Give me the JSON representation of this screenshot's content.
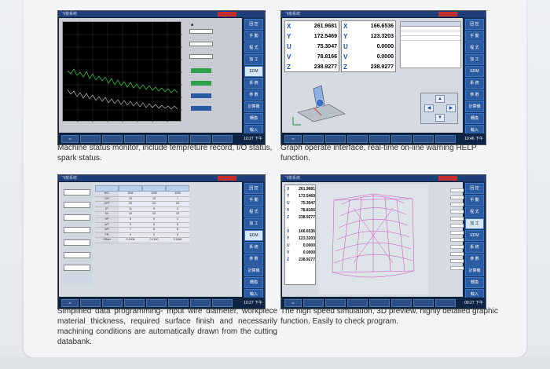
{
  "panels": [
    {
      "caption": "Machine status monitor, include tempreture record, I/O status, spark status.",
      "right_menu": [
        "回 控",
        "手 動",
        "程 式",
        "加 工",
        "EDM",
        "系 統",
        "参 數",
        "計算機",
        "轉換",
        "輸入"
      ],
      "bottom_buttons": [
        "",
        "",
        "",
        "",
        "",
        "",
        "",
        ""
      ],
      "time": "10:27 下午"
    },
    {
      "caption": "Graph operate interface, real-time on-line warning HELP function.",
      "coords_left": [
        {
          "axis": "X",
          "value": "261.9681"
        },
        {
          "axis": "Y",
          "value": "172.5469"
        },
        {
          "axis": "U",
          "value": "75.3047"
        },
        {
          "axis": "V",
          "value": "78.8166"
        },
        {
          "axis": "Z",
          "value": "238.9277"
        }
      ],
      "coords_right": [
        {
          "axis": "X",
          "value": "166.6536"
        },
        {
          "axis": "Y",
          "value": "123.3203"
        },
        {
          "axis": "U",
          "value": "0.0000"
        },
        {
          "axis": "V",
          "value": "0.0000"
        },
        {
          "axis": "Z",
          "value": "238.9277"
        }
      ],
      "right_menu": [
        "回 控",
        "手 動",
        "程 式",
        "加 工",
        "EDM",
        "系 統",
        "参 數",
        "計算機",
        "轉換",
        "輸入"
      ],
      "time": "10:46 下午"
    },
    {
      "caption": "Simplified data programming- Input wire diameter, workpiece material thickness, required surface finish and necessarily machining conditions are automatically drawn from the cutting databank.",
      "table_rows": [
        [
          "NO.",
          "1/N1",
          "1/N2",
          "1/N3"
        ],
        [
          "ON",
          "10",
          "15",
          "7"
        ],
        [
          "OFF",
          "20",
          "23",
          "23"
        ],
        [
          "IP",
          "11",
          "9",
          "2"
        ],
        [
          "SV",
          "10",
          "12",
          "10"
        ],
        [
          "HP",
          "5",
          "9",
          "1"
        ],
        [
          "WT",
          "5",
          "6",
          "6"
        ],
        [
          "WP",
          "7",
          "8",
          "6"
        ],
        [
          "FR",
          "9",
          "5",
          "8"
        ],
        [
          "Offset",
          "0.1906",
          "0.1240",
          "0.1180"
        ]
      ],
      "right_menu": [
        "回 控",
        "手 動",
        "程 式",
        "加 工",
        "EDM",
        "系 統",
        "参 數",
        "計算機",
        "轉換",
        "輸入"
      ],
      "time": "10:27 下午"
    },
    {
      "caption": "The high speed simulation, 3D preview, highly detailed graphic function. Easily to check program.",
      "coords_top": [
        {
          "axis": "X",
          "value": "261.9681"
        },
        {
          "axis": "Y",
          "value": "172.5469"
        },
        {
          "axis": "U",
          "value": "75.3047"
        },
        {
          "axis": "V",
          "value": "78.8166"
        },
        {
          "axis": "Z",
          "value": "238.9277"
        }
      ],
      "coords_bottom": [
        {
          "axis": "X",
          "value": "166.6536"
        },
        {
          "axis": "Y",
          "value": "123.3203"
        },
        {
          "axis": "U",
          "value": "0.0000"
        },
        {
          "axis": "V",
          "value": "0.0000"
        },
        {
          "axis": "Z",
          "value": "238.9277"
        }
      ],
      "right_menu": [
        "回 控",
        "手 動",
        "程 式",
        "加 工",
        "EDM",
        "系 統",
        "参 數",
        "計算機",
        "轉換",
        "輸入"
      ],
      "time": "09:27 下午"
    }
  ]
}
